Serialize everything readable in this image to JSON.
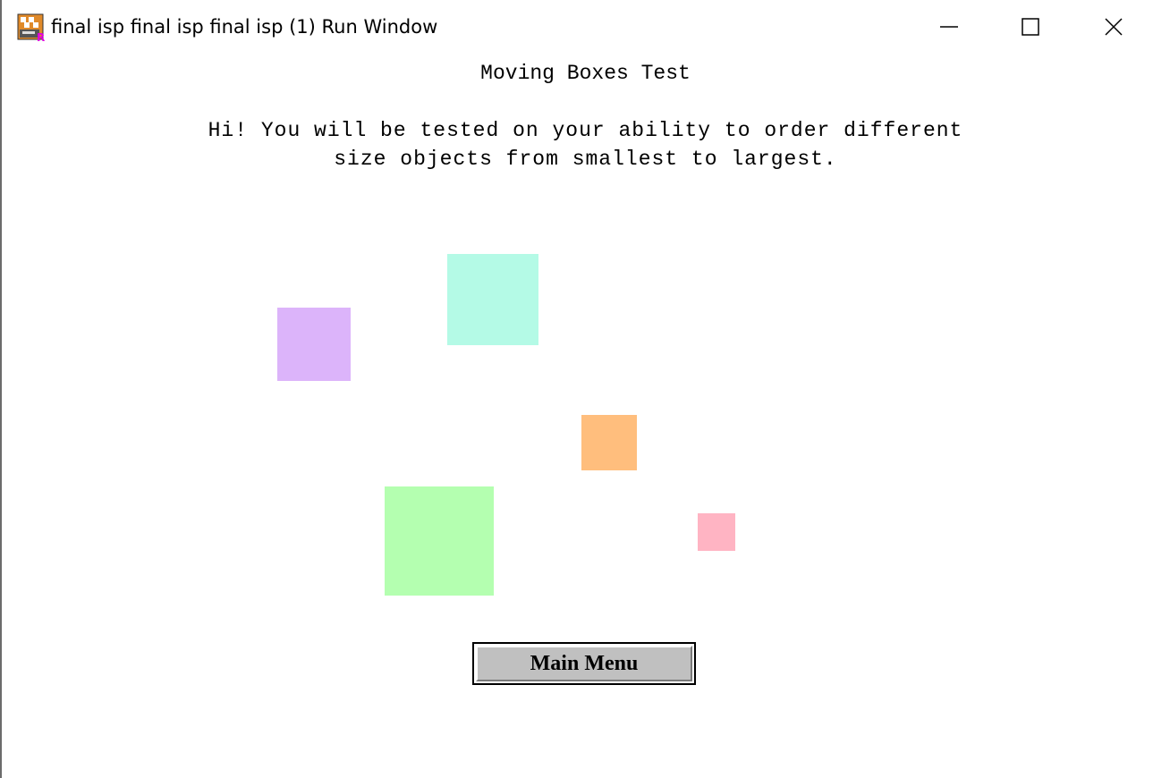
{
  "window": {
    "title": "final isp final isp final isp (1) Run Window",
    "app_icon": "ready-app-icon"
  },
  "content": {
    "heading": "Moving Boxes Test",
    "intro_line1": "Hi! You will be tested on your ability to order different",
    "intro_line2": "size objects from smallest to largest."
  },
  "boxes": [
    {
      "name": "purple-box",
      "color": "#dcb4fa"
    },
    {
      "name": "cyan-box",
      "color": "#b4fae6"
    },
    {
      "name": "orange-box",
      "color": "#ffbe7d"
    },
    {
      "name": "green-box",
      "color": "#b4ffb0"
    },
    {
      "name": "pink-box",
      "color": "#ffb4c3"
    }
  ],
  "buttons": {
    "main_menu": "Main Menu"
  }
}
